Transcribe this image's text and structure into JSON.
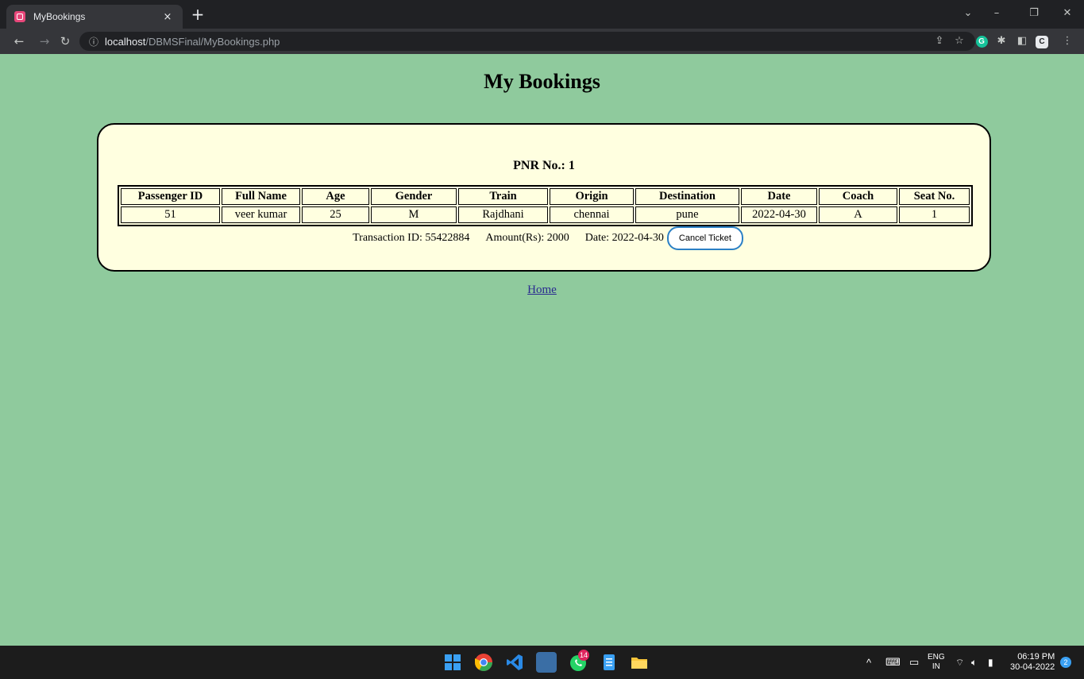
{
  "browser": {
    "tab_title": "MyBookings",
    "tab_close": "×",
    "new_tab": "+",
    "url_host": "localhost",
    "url_path": "/DBMSFinal/MyBookings.php",
    "window_controls": {
      "dropdown": "⌄",
      "minimize": "–",
      "restore": "❐",
      "close": "✕"
    }
  },
  "page": {
    "title": "My Bookings",
    "pnr_label": "PNR No.: 1",
    "table": {
      "headers": [
        "Passenger ID",
        "Full Name",
        "Age",
        "Gender",
        "Train",
        "Origin",
        "Destination",
        "Date",
        "Coach",
        "Seat No."
      ],
      "rows": [
        [
          "51",
          "veer kumar",
          "25",
          "M",
          "Rajdhani",
          "chennai",
          "pune",
          "2022-04-30",
          "A",
          "1"
        ]
      ]
    },
    "transaction_id": "Transaction ID: 55422884",
    "amount": "Amount(Rs): 2000",
    "date": "Date: 2022-04-30",
    "cancel_button": "Cancel Ticket",
    "home_link": "Home"
  },
  "taskbar": {
    "tray": {
      "lang_top": "ENG",
      "lang_bottom": "IN",
      "time": "06:19 PM",
      "date": "30-04-2022",
      "notif_count": "2"
    },
    "whatsapp_badge": "14"
  }
}
